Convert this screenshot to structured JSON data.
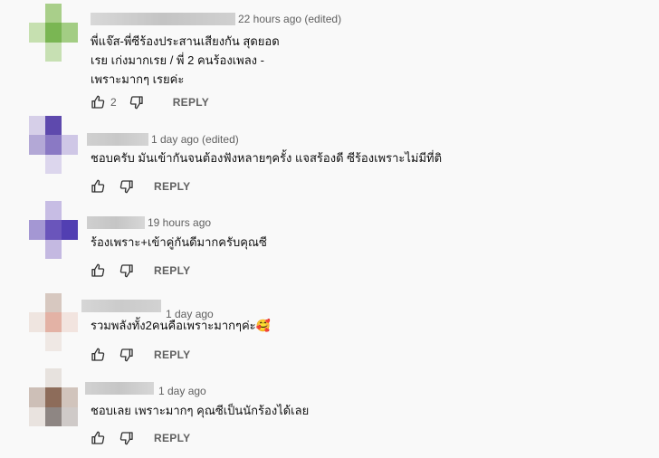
{
  "comments": [
    {
      "author": "",
      "time": "22 hours ago (edited)",
      "text": "พี่แจ๊ส-พี่ซีร้องประสานเสียงกัน สุดยอด\nเรย เก่งมากเรย / พี่ 2 คนร้องเพลง -\nเพราะมากๆ เรยค่ะ",
      "likes": "2",
      "reply": "REPLY",
      "avatar_colors": [
        "#f9f9f9",
        "#a9cf8a",
        "#f9f9f9",
        "#c6e0b0",
        "#7ab653",
        "#a3cd84",
        "#f9f9f9",
        "#c7e0b3",
        "#f9f9f9"
      ],
      "name_colors": [
        "#d8d8d8",
        "#c4c4c4",
        "#d0d0d0"
      ]
    },
    {
      "author": "",
      "time": "1 day ago (edited)",
      "text": "ชอบครับ มันเข้ากันจนต้องฟังหลายๆครั้ง แจสร้องดี ซีร้องเพราะไม่มีที่ติ",
      "likes": "",
      "reply": "REPLY",
      "avatar_colors": [
        "#d6cfe8",
        "#5e49ad",
        "#f9f9f9",
        "#b3a8d6",
        "#8a79c4",
        "#cfc7e6",
        "#f9f9f9",
        "#dcd6ed",
        "#f9f9f9"
      ],
      "name_colors": [
        "#d0d0d0",
        "#c8c8c8",
        "#d4d4d4"
      ]
    },
    {
      "author": "",
      "time": "19 hours ago",
      "text": "ร้องเพราะ+เข้าคู่กันดีมากครับคุณซี",
      "likes": "",
      "reply": "REPLY",
      "avatar_colors": [
        "#f9f9f9",
        "#c7bde4",
        "#f9f9f9",
        "#a497d3",
        "#6a55bb",
        "#523fb2",
        "#f9f9f9",
        "#c4b9e1",
        "#f9f9f9"
      ],
      "name_colors": [
        "#cfcfcf",
        "#c5c5c5",
        "#d7d7d7"
      ]
    },
    {
      "author": "",
      "time": "1 day ago",
      "text": "รวมพลังทั้ง2คนคือเพราะมากๆค่ะ🥰",
      "likes": "",
      "reply": "REPLY",
      "avatar_colors": [
        "#f9f9f9",
        "#d7c8c0",
        "#f9f9f9",
        "#efe5e0",
        "#e3b2a5",
        "#f2e4df",
        "#f9f9f9",
        "#efe8e4",
        "#f9f9f9"
      ],
      "name_colors": [
        "#d6d6d6",
        "#cbcbcb",
        "#d2d2d2"
      ]
    },
    {
      "author": "",
      "time": "1 day ago",
      "text": "ชอบเลย เพราะมากๆ คุณซีเป็นนักร้องได้เลย",
      "likes": "",
      "reply": "REPLY",
      "avatar_colors": [
        "#f9f9f9",
        "#e7e2de",
        "#f9f9f9",
        "#cdbfb7",
        "#8d6c5a",
        "#d1c4bc",
        "#e9e3df",
        "#8e8683",
        "#cfcac8"
      ],
      "name_colors": [
        "#d1d1d1",
        "#c6c6c6",
        "#d6d6d6"
      ]
    }
  ]
}
